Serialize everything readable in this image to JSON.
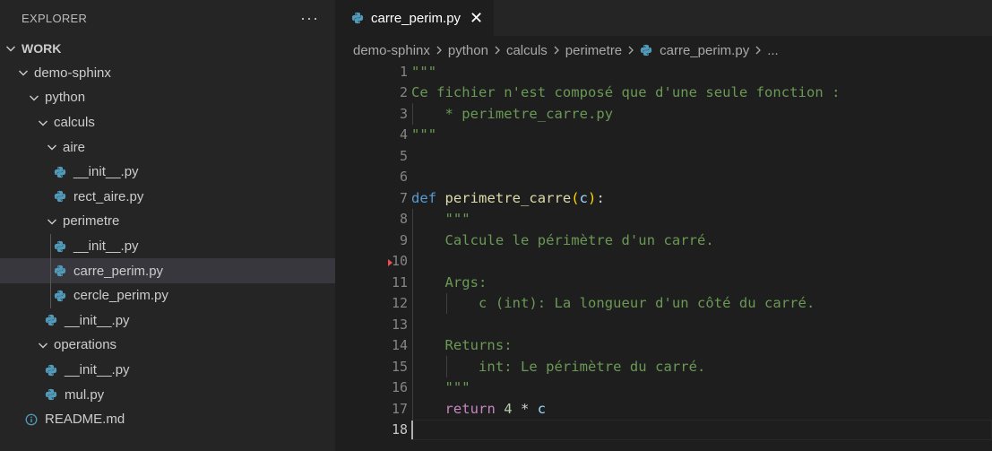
{
  "sidebar": {
    "title": "EXPLORER",
    "more_label": "···",
    "tree": [
      {
        "label": "WORK",
        "depth": 0,
        "kind": "folder",
        "root": true
      },
      {
        "label": "demo-sphinx",
        "depth": 1,
        "kind": "folder"
      },
      {
        "label": "python",
        "depth": 2,
        "kind": "folder"
      },
      {
        "label": "calculs",
        "depth": 3,
        "kind": "folder"
      },
      {
        "label": "aire",
        "depth": 4,
        "kind": "folder"
      },
      {
        "label": "__init__.py",
        "depth": 5,
        "kind": "py"
      },
      {
        "label": "rect_aire.py",
        "depth": 5,
        "kind": "py"
      },
      {
        "label": "perimetre",
        "depth": 4,
        "kind": "folder"
      },
      {
        "label": "__init__.py",
        "depth": 5,
        "kind": "py"
      },
      {
        "label": "carre_perim.py",
        "depth": 5,
        "kind": "py",
        "selected": true
      },
      {
        "label": "cercle_perim.py",
        "depth": 5,
        "kind": "py"
      },
      {
        "label": "__init__.py",
        "depth": 4,
        "kind": "py"
      },
      {
        "label": "operations",
        "depth": 3,
        "kind": "folder"
      },
      {
        "label": "__init__.py",
        "depth": 4,
        "kind": "py"
      },
      {
        "label": "mul.py",
        "depth": 4,
        "kind": "py"
      },
      {
        "label": "README.md",
        "depth": 2,
        "kind": "info"
      }
    ]
  },
  "editor": {
    "tab": {
      "label": "carre_perim.py",
      "close_icon": "close-icon"
    },
    "breadcrumb": [
      "demo-sphinx",
      "python",
      "calculs",
      "perimetre"
    ],
    "breadcrumb_file": "carre_perim.py",
    "breadcrumb_tail": "...",
    "active_line": 18,
    "lines": [
      {
        "n": "1",
        "tokens": [
          {
            "t": "\"\"\"",
            "c": "c-str"
          }
        ]
      },
      {
        "n": "2",
        "tokens": [
          {
            "t": "Ce fichier n'est composé que d'une seule fonction :",
            "c": "c-str"
          }
        ]
      },
      {
        "n": "3",
        "tokens": [
          {
            "t": "    * perimetre_carre.py",
            "c": "c-str"
          }
        ]
      },
      {
        "n": "4",
        "tokens": [
          {
            "t": "\"\"\"",
            "c": "c-str"
          }
        ]
      },
      {
        "n": "5",
        "tokens": []
      },
      {
        "n": "6",
        "tokens": []
      },
      {
        "n": "7",
        "tokens": [
          {
            "t": "def ",
            "c": "c-kw"
          },
          {
            "t": "perimetre_carre",
            "c": "c-fn"
          },
          {
            "t": "(",
            "c": "c-par"
          },
          {
            "t": "c",
            "c": "c-var"
          },
          {
            "t": ")",
            "c": "c-par"
          },
          {
            "t": ":",
            "c": "c-op"
          }
        ]
      },
      {
        "n": "8",
        "tokens": [
          {
            "t": "    \"\"\"",
            "c": "c-str"
          }
        ]
      },
      {
        "n": "9",
        "tokens": [
          {
            "t": "    Calcule le périmètre d'un carré.",
            "c": "c-str"
          }
        ]
      },
      {
        "n": "10",
        "tokens": []
      },
      {
        "n": "11",
        "tokens": [
          {
            "t": "    Args:",
            "c": "c-str"
          }
        ]
      },
      {
        "n": "12",
        "tokens": [
          {
            "t": "        c (int): La longueur d'un côté du carré.",
            "c": "c-str"
          }
        ]
      },
      {
        "n": "13",
        "tokens": []
      },
      {
        "n": "14",
        "tokens": [
          {
            "t": "    Returns:",
            "c": "c-str"
          }
        ]
      },
      {
        "n": "15",
        "tokens": [
          {
            "t": "        int: Le périmètre du carré.",
            "c": "c-str"
          }
        ]
      },
      {
        "n": "16",
        "tokens": [
          {
            "t": "    \"\"\"",
            "c": "c-str"
          }
        ]
      },
      {
        "n": "17",
        "tokens": [
          {
            "t": "    ",
            "c": "c-op"
          },
          {
            "t": "return ",
            "c": "c-ctl"
          },
          {
            "t": "4",
            "c": "c-num"
          },
          {
            "t": " * ",
            "c": "c-op"
          },
          {
            "t": "c",
            "c": "c-var"
          }
        ]
      },
      {
        "n": "18",
        "tokens": []
      }
    ]
  },
  "colors": {
    "sidebar_bg": "#252526",
    "editor_bg": "#1e1e1e",
    "selection_bg": "#37373d",
    "python_icon": "#519aba",
    "info_icon": "#519aba",
    "string": "#6a9955",
    "keyword": "#569cd6"
  }
}
